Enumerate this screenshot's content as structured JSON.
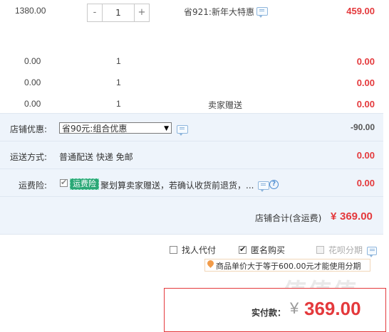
{
  "item_row": {
    "unit_price": "1380.00",
    "quantity": "1",
    "minus": "-",
    "plus": "+",
    "promo": "省921:新年大特惠",
    "subtotal": "459.00"
  },
  "gift_rows": [
    {
      "price": "0.00",
      "qty": "1",
      "note": "",
      "subtotal": "0.00"
    },
    {
      "price": "0.00",
      "qty": "1",
      "note": "",
      "subtotal": "0.00"
    },
    {
      "price": "0.00",
      "qty": "1",
      "note": "卖家赠送",
      "subtotal": "0.00"
    }
  ],
  "shop_discount": {
    "label": "店铺优惠:",
    "selected": "省90元:组合优惠",
    "amount": "-90.00"
  },
  "shipping": {
    "label": "运送方式:",
    "value": "普通配送 快递 免邮",
    "amount": "0.00"
  },
  "insurance": {
    "label": "运费险:",
    "tag": "运费险",
    "text": "聚划算卖家赠送，若确认收货前退货，...",
    "amount": "0.00",
    "help": "?"
  },
  "shop_total": {
    "label": "店铺合计(含运费)",
    "currency": "¥",
    "amount": "369.00"
  },
  "options": {
    "pay_for_me": "找人代付",
    "anonymous": "匿名购买",
    "huabei": "花呗分期",
    "anonymous_checked": true,
    "tip": "商品单价大于等于600.00元才能使用分期"
  },
  "payment": {
    "label": "实付款：",
    "currency": "¥",
    "amount": "369.00"
  },
  "watermark": "值值值",
  "colors": {
    "accent_red": "#e4393c",
    "panel_bg": "#eef4fb",
    "insurance_green": "#2aa776"
  }
}
